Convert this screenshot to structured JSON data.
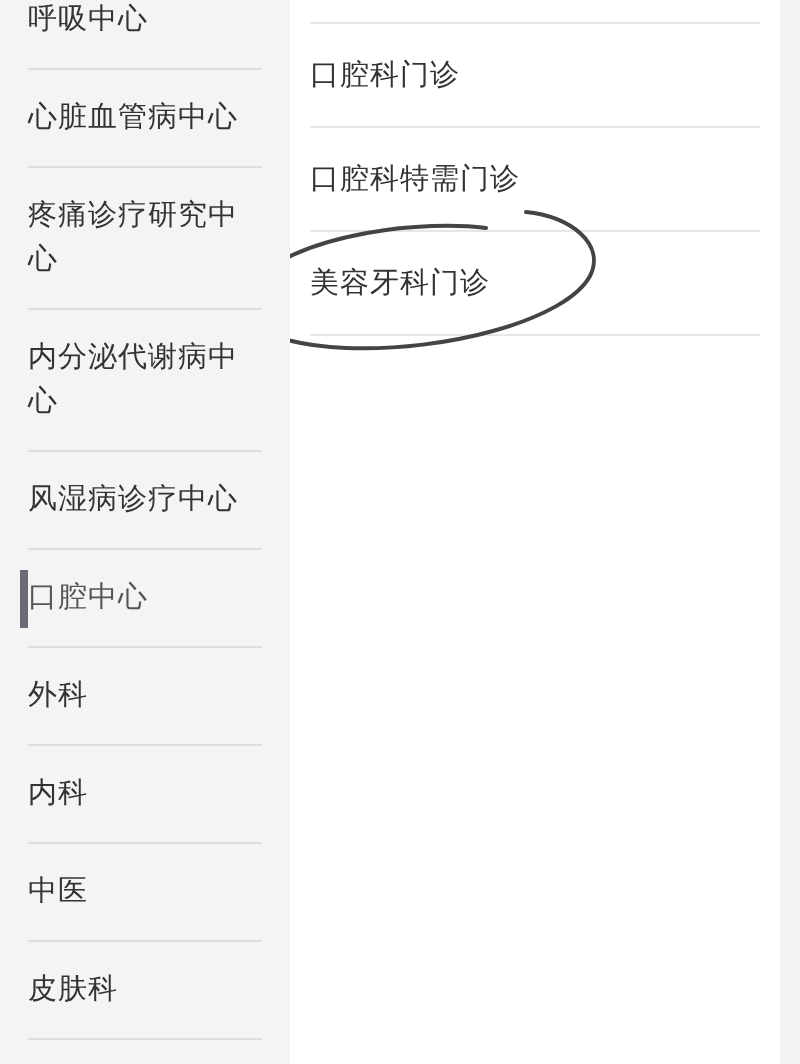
{
  "departments": [
    {
      "label": "呼吸中心",
      "selected": false
    },
    {
      "label": "心脏血管病中心",
      "selected": false
    },
    {
      "label": "疼痛诊疗研究中心",
      "selected": false
    },
    {
      "label": "内分泌代谢病中心",
      "selected": false
    },
    {
      "label": "风湿病诊疗中心",
      "selected": false
    },
    {
      "label": "口腔中心",
      "selected": true
    },
    {
      "label": "外科",
      "selected": false
    },
    {
      "label": "内科",
      "selected": false
    },
    {
      "label": "中医",
      "selected": false
    },
    {
      "label": "皮肤科",
      "selected": false
    }
  ],
  "clinics": [
    {
      "label": "口腔科门诊",
      "circled": false
    },
    {
      "label": "口腔科特需门诊",
      "circled": false
    },
    {
      "label": "美容牙科门诊",
      "circled": true
    }
  ]
}
